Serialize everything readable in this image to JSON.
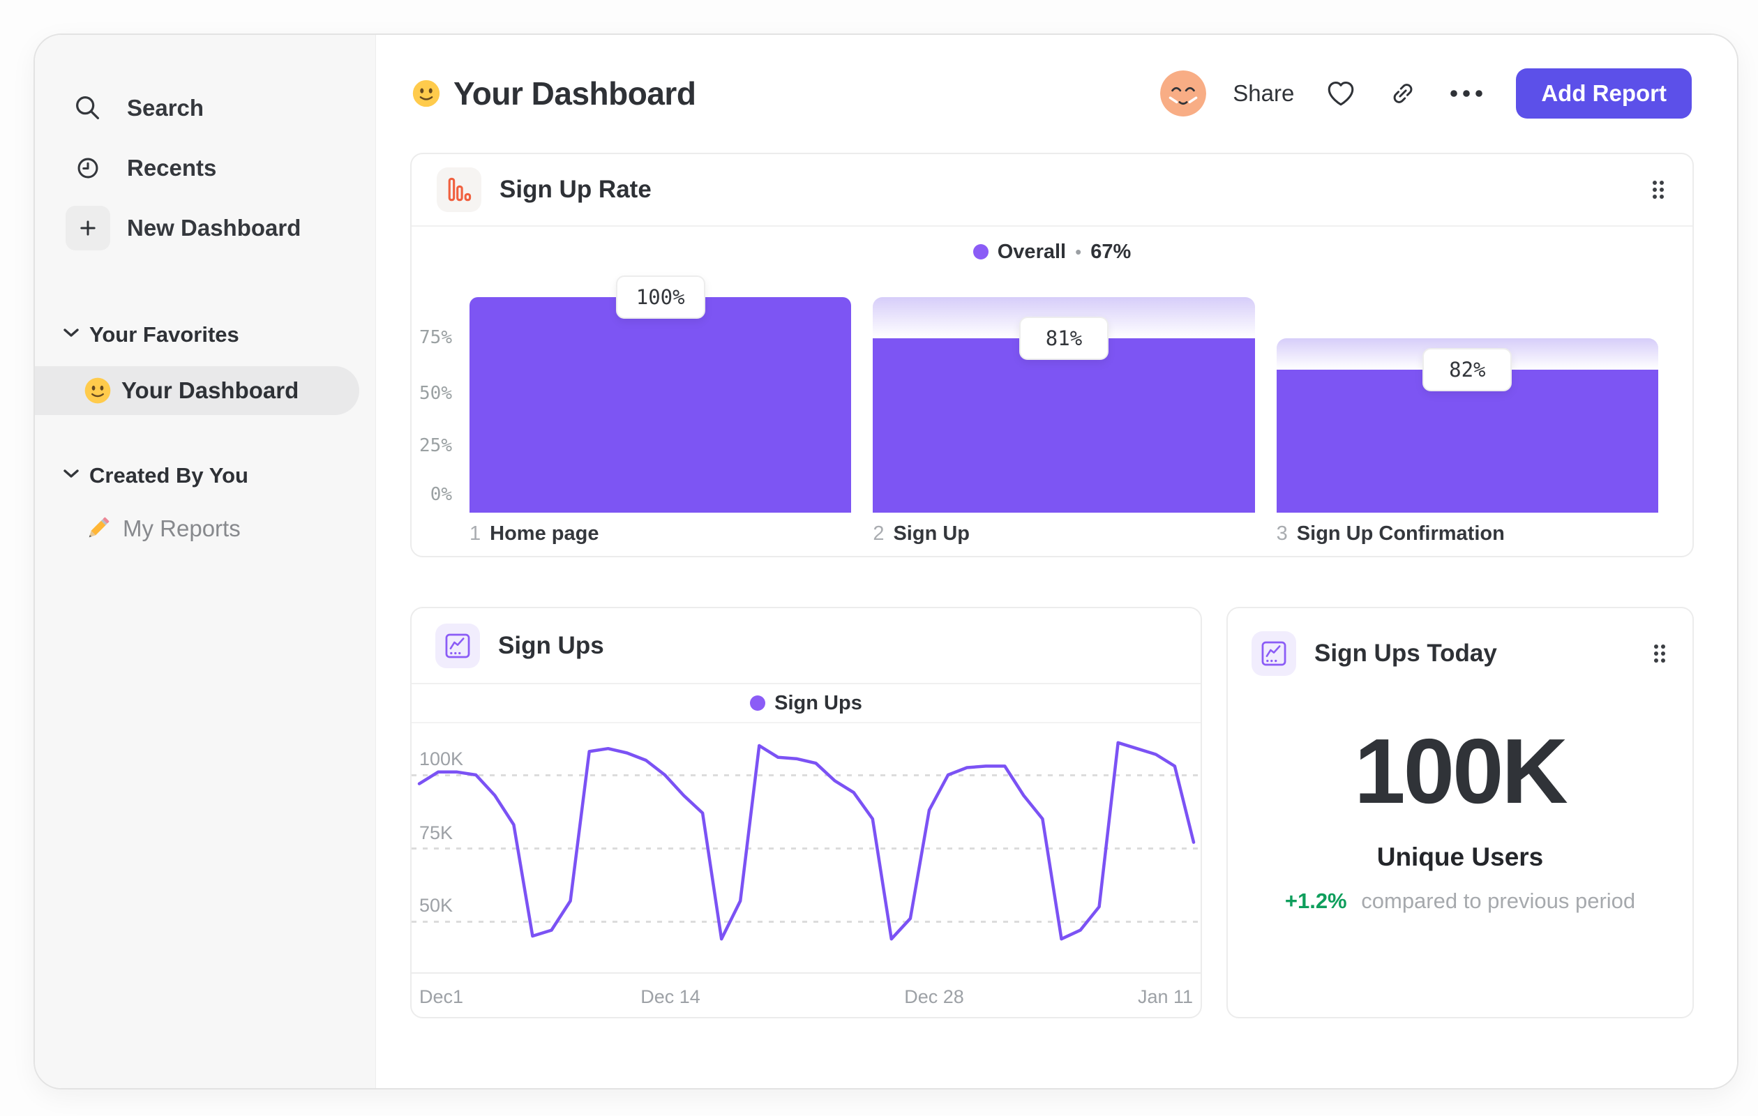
{
  "sidebar": {
    "items": [
      {
        "icon": "search-icon",
        "label": "Search"
      },
      {
        "icon": "clock-icon",
        "label": "Recents"
      },
      {
        "icon": "plus-icon",
        "label": "New Dashboard"
      }
    ],
    "sections": [
      {
        "label": "Your Favorites",
        "items": [
          {
            "icon": "smiley-emoji",
            "label": "Your Dashboard",
            "selected": true
          }
        ]
      },
      {
        "label": "Created By You",
        "items": [
          {
            "icon": "pencil-emoji",
            "label": "My Reports",
            "selected": false
          }
        ]
      }
    ]
  },
  "header": {
    "emoji": "smiley-emoji",
    "title": "Your Dashboard",
    "share_label": "Share",
    "add_report_label": "Add Report"
  },
  "funnel_card": {
    "title": "Sign Up Rate",
    "legend_label": "Overall",
    "legend_sep": "•",
    "legend_value": "67%",
    "yticks": [
      "75%",
      "50%",
      "25%",
      "0%"
    ]
  },
  "line_card": {
    "title": "Sign Ups",
    "legend_label": "Sign Ups",
    "yticks": [
      "100K",
      "75K",
      "50K"
    ],
    "xticks": [
      "Dec1",
      "Dec 14",
      "Dec 28",
      "Jan 11"
    ]
  },
  "kpi_card": {
    "title": "Sign Ups Today",
    "value": "100K",
    "label": "Unique Users",
    "delta": "+1.2%",
    "delta_note": "compared to previous period"
  },
  "colors": {
    "bar_purple": "#7d55f3",
    "line_purple": "#7b52f4",
    "legend_purple": "#8b5cf6",
    "button_indigo": "#5c50e9",
    "funnel_icon_orange": "#f0603f",
    "positive_green": "#0e9e5c"
  },
  "chart_data": [
    {
      "type": "bar",
      "subtype": "funnel",
      "title": "Sign Up Rate",
      "categories": [
        "Home page",
        "Sign Up",
        "Sign Up Confirmation"
      ],
      "step_conversion_pct": [
        100,
        81,
        82
      ],
      "overall_pct": [
        100,
        81,
        66.4
      ],
      "overall_label": "Overall",
      "overall_value_pct": 67,
      "yticks_pct": [
        0,
        25,
        50,
        75
      ],
      "ylim": [
        0,
        100
      ],
      "legend_position": "top-center",
      "grid": "off"
    },
    {
      "type": "line",
      "title": "Sign Ups",
      "series": [
        {
          "name": "Sign Ups",
          "values_thousands": [
            97,
            101,
            101,
            100,
            93,
            83,
            45,
            47,
            57,
            108,
            109,
            107.5,
            105,
            100,
            93,
            87,
            44,
            57,
            110,
            106,
            105.5,
            104,
            98,
            94,
            85,
            44,
            51,
            88,
            100,
            102.5,
            103,
            103,
            93,
            85,
            44,
            47,
            55,
            111,
            109,
            107,
            103,
            77
          ]
        }
      ],
      "x_start": "Dec 1",
      "x_end": "Jan 11",
      "xticks": [
        "Dec1",
        "Dec 14",
        "Dec 28",
        "Jan 11"
      ],
      "yticks_thousands": [
        50,
        75,
        100
      ],
      "ylim_thousands": [
        32,
        117
      ],
      "grid": "dotted-horizontal",
      "legend_position": "top-center"
    },
    {
      "type": "kpi",
      "title": "Sign Ups Today",
      "value": "100K",
      "metric": "Unique Users",
      "delta_pct": "+1.2%",
      "comparison": "compared to previous period"
    }
  ]
}
